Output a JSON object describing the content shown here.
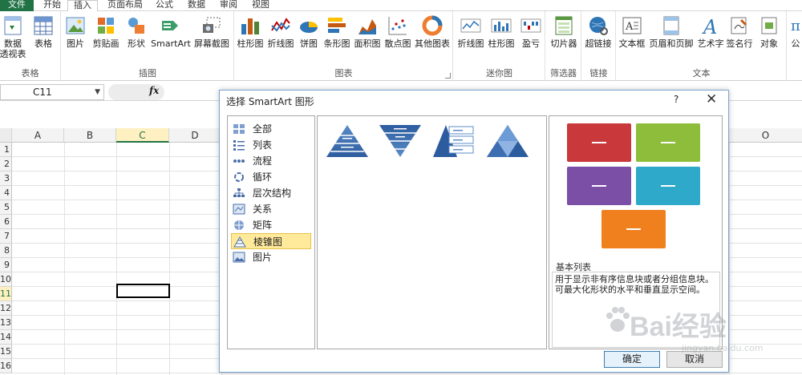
{
  "ribbon": {
    "tabs": [
      "文件",
      "开始",
      "插入",
      "页面布局",
      "公式",
      "数据",
      "审阅",
      "视图"
    ],
    "active_tab": "插入",
    "groups": {
      "tables": {
        "label": "表格",
        "btn1": "数据",
        "btn1b": "透视表",
        "btn2": "表格"
      },
      "illustrations": {
        "label": "插图",
        "btn1": "图片",
        "btn2": "剪贴画",
        "btn3": "形状",
        "btn4": "SmartArt",
        "btn5": "屏幕截图"
      },
      "charts": {
        "label": "图表",
        "btn1": "柱形图",
        "btn2": "折线图",
        "btn3": "饼图",
        "btn4": "条形图",
        "btn5": "面积图",
        "btn6": "散点图",
        "btn7": "其他图表"
      },
      "sparklines": {
        "label": "迷你图",
        "btn1": "折线图",
        "btn2": "柱形图",
        "btn3": "盈亏"
      },
      "filter": {
        "label": "筛选器",
        "btn1": "切片器"
      },
      "links": {
        "label": "链接",
        "btn1": "超链接"
      },
      "text": {
        "label": "文本",
        "btn1": "文本框",
        "btn2": "页眉和页脚",
        "btn3": "艺术字",
        "btn4": "签名行",
        "btn5": "对象"
      },
      "symbols": {
        "btn1": "公"
      }
    }
  },
  "formula_bar": {
    "name_box": "C11",
    "fx": "fx"
  },
  "sheet": {
    "columns": [
      "A",
      "B",
      "C",
      "D",
      "O"
    ],
    "selected_column": "C",
    "rows": [
      "1",
      "2",
      "3",
      "4",
      "5",
      "6",
      "7",
      "8",
      "9",
      "10",
      "11",
      "12",
      "13",
      "14",
      "15",
      "16"
    ],
    "selected_row": "11",
    "active_cell": "C11"
  },
  "dialog": {
    "title": "选择 SmartArt 图形",
    "help": "?",
    "close": "✕",
    "categories": [
      "全部",
      "列表",
      "流程",
      "循环",
      "层次结构",
      "关系",
      "矩阵",
      "棱锥图",
      "图片"
    ],
    "selected_category": "棱锥图",
    "preview": {
      "title": "基本列表",
      "description": "用于显示非有序信息块或者分组信息块。可最大化形状的水平和垂直显示空间。",
      "colors": [
        "#c9383b",
        "#8dbd3a",
        "#7b4fa6",
        "#2fa9c9",
        "#f07f1e"
      ]
    },
    "ok": "确定",
    "cancel": "取消"
  },
  "watermark": {
    "brand": "Bai经验",
    "url": "jingyan.baidu.com"
  }
}
